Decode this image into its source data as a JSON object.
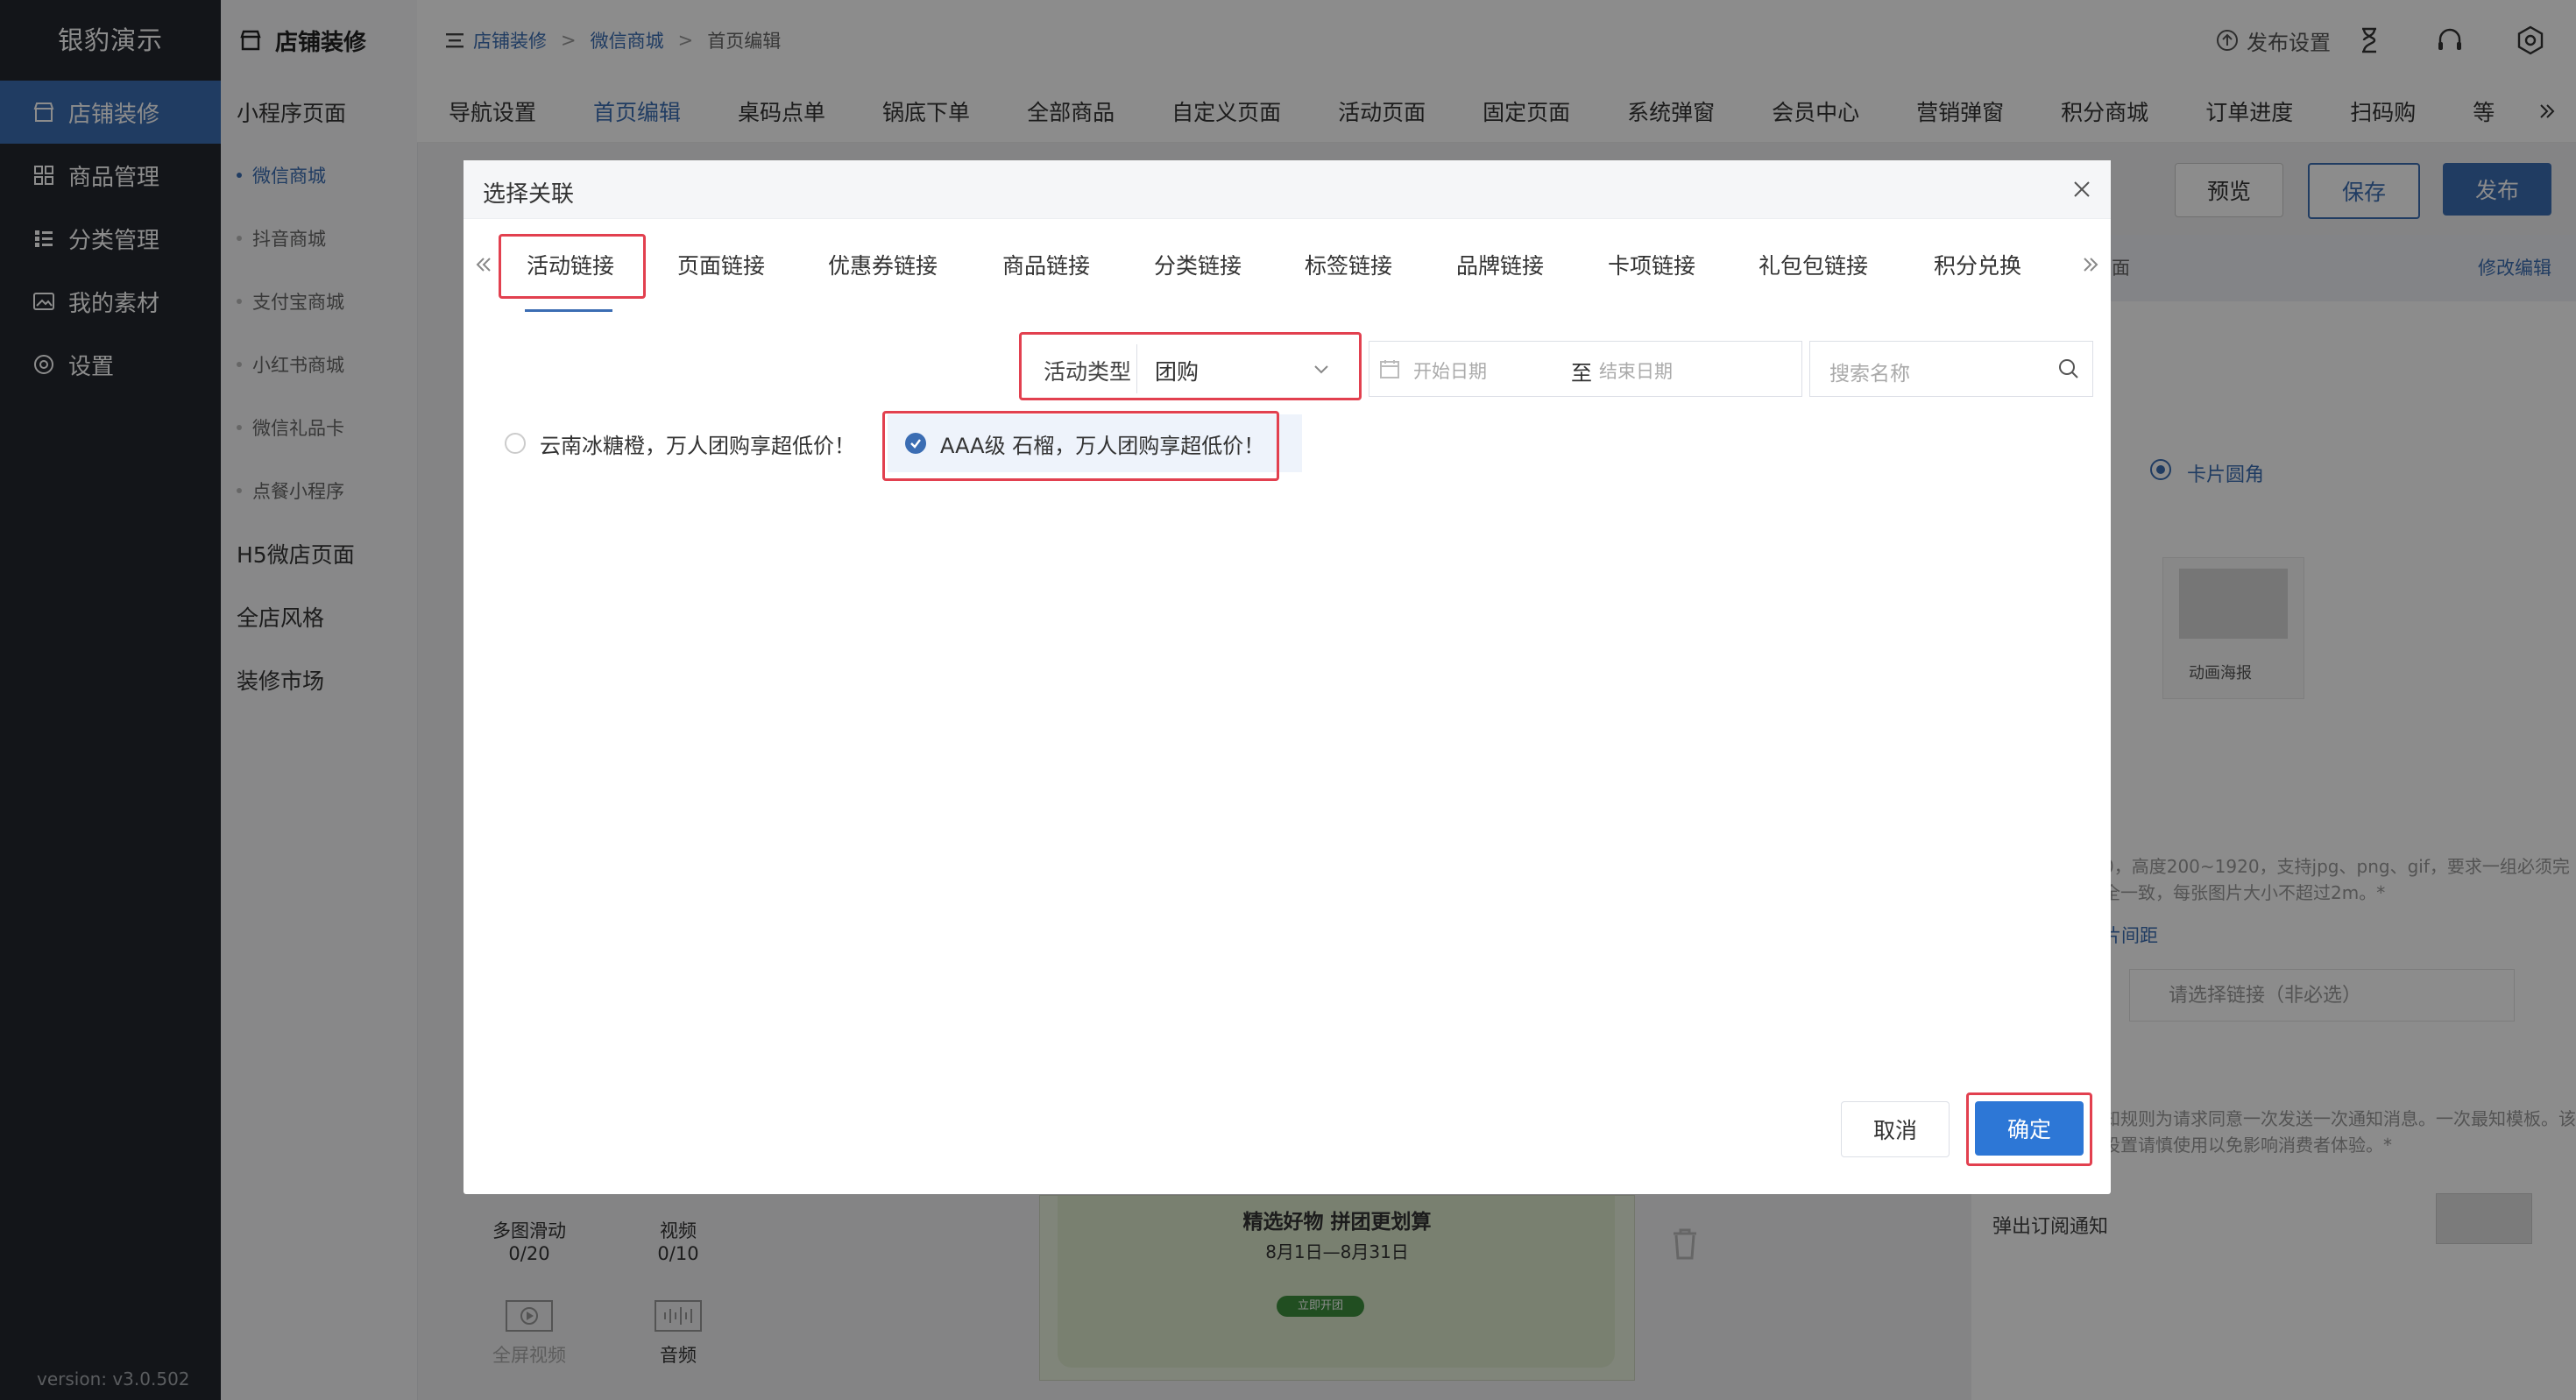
{
  "sidebar": {
    "brand": "银豹演示",
    "items": [
      {
        "label": "店铺装修",
        "icon": "store-icon",
        "active": true
      },
      {
        "label": "商品管理",
        "icon": "grid-icon",
        "active": false
      },
      {
        "label": "分类管理",
        "icon": "list-icon",
        "active": false
      },
      {
        "label": "我的素材",
        "icon": "image-icon",
        "active": false
      },
      {
        "label": "设置",
        "icon": "gear-icon",
        "active": false
      }
    ],
    "version": "version: v3.0.502"
  },
  "subnav": {
    "header": "店铺装修",
    "mini_program": "小程序页面",
    "sub_items": [
      {
        "label": "微信商城",
        "active": true
      },
      {
        "label": "抖音商城",
        "active": false
      },
      {
        "label": "支付宝商城",
        "active": false
      },
      {
        "label": "小红书商城",
        "active": false
      },
      {
        "label": "微信礼品卡",
        "active": false
      },
      {
        "label": "点餐小程序",
        "active": false
      }
    ],
    "h5": "H5微店页面",
    "style": "全店风格",
    "market": "装修市场"
  },
  "topbar": {
    "breadcrumb": [
      "店铺装修",
      "微信商城",
      "首页编辑"
    ],
    "breadcrumb_sep": ">",
    "publish_settings": "发布设置"
  },
  "tabs": [
    "导航设置",
    "首页编辑",
    "桌码点单",
    "锅底下单",
    "全部商品",
    "自定义页面",
    "活动页面",
    "固定页面",
    "系统弹窗",
    "会员中心",
    "营销弹窗",
    "积分商城",
    "订单进度",
    "扫码购",
    "等"
  ],
  "active_tab": "首页编辑",
  "actions": {
    "preview": "预览",
    "save": "保存",
    "publish": "发布"
  },
  "right_panel": {
    "header_partial": "面",
    "edit": "修改编辑",
    "card_radius": "卡片圆角",
    "anim_poster": "动画海报",
    "help_text": "0，高度200~1920，支持jpg、png、gif，要求一组必须完全一致，每张图片大小不超过2m。*",
    "image_gap": "片间距",
    "link_placeholder": "请选择链接（非必选）",
    "help_text2": "知规则为请求同意一次发送一次通知消息。一次最知模板。该设置请慎使用以免影响消费者体验。*",
    "subscribe_notice": "弹出订阅通知"
  },
  "widgets": [
    {
      "name": "多图滑动",
      "count": "0/20"
    },
    {
      "name": "视频",
      "count": "0/10"
    },
    {
      "name": "全屏视频",
      "count": ""
    },
    {
      "name": "音频",
      "count": ""
    }
  ],
  "preview_banner": {
    "title": "精选好物 拼团更划算",
    "date": "8月1日—8月31日",
    "cta": "立即开团"
  },
  "modal": {
    "title": "选择关联",
    "link_tabs": [
      "活动链接",
      "页面链接",
      "优惠券链接",
      "商品链接",
      "分类链接",
      "标签链接",
      "品牌链接",
      "卡项链接",
      "礼包包链接",
      "积分兑换"
    ],
    "active_link_tab": "活动链接",
    "filter": {
      "type_label": "活动类型",
      "type_value": "团购",
      "start_placeholder": "开始日期",
      "to": "至",
      "end_placeholder": "结束日期",
      "search_placeholder": "搜索名称"
    },
    "options": [
      {
        "label": "云南冰糖橙，万人团购享超低价！",
        "checked": false
      },
      {
        "label": "AAA级 石榴，万人团购享超低价！",
        "checked": true
      }
    ],
    "cancel": "取消",
    "confirm": "确定"
  },
  "colors": {
    "accent": "#3b6db3",
    "highlight": "#e2404f",
    "sidebar": "#23272e"
  }
}
